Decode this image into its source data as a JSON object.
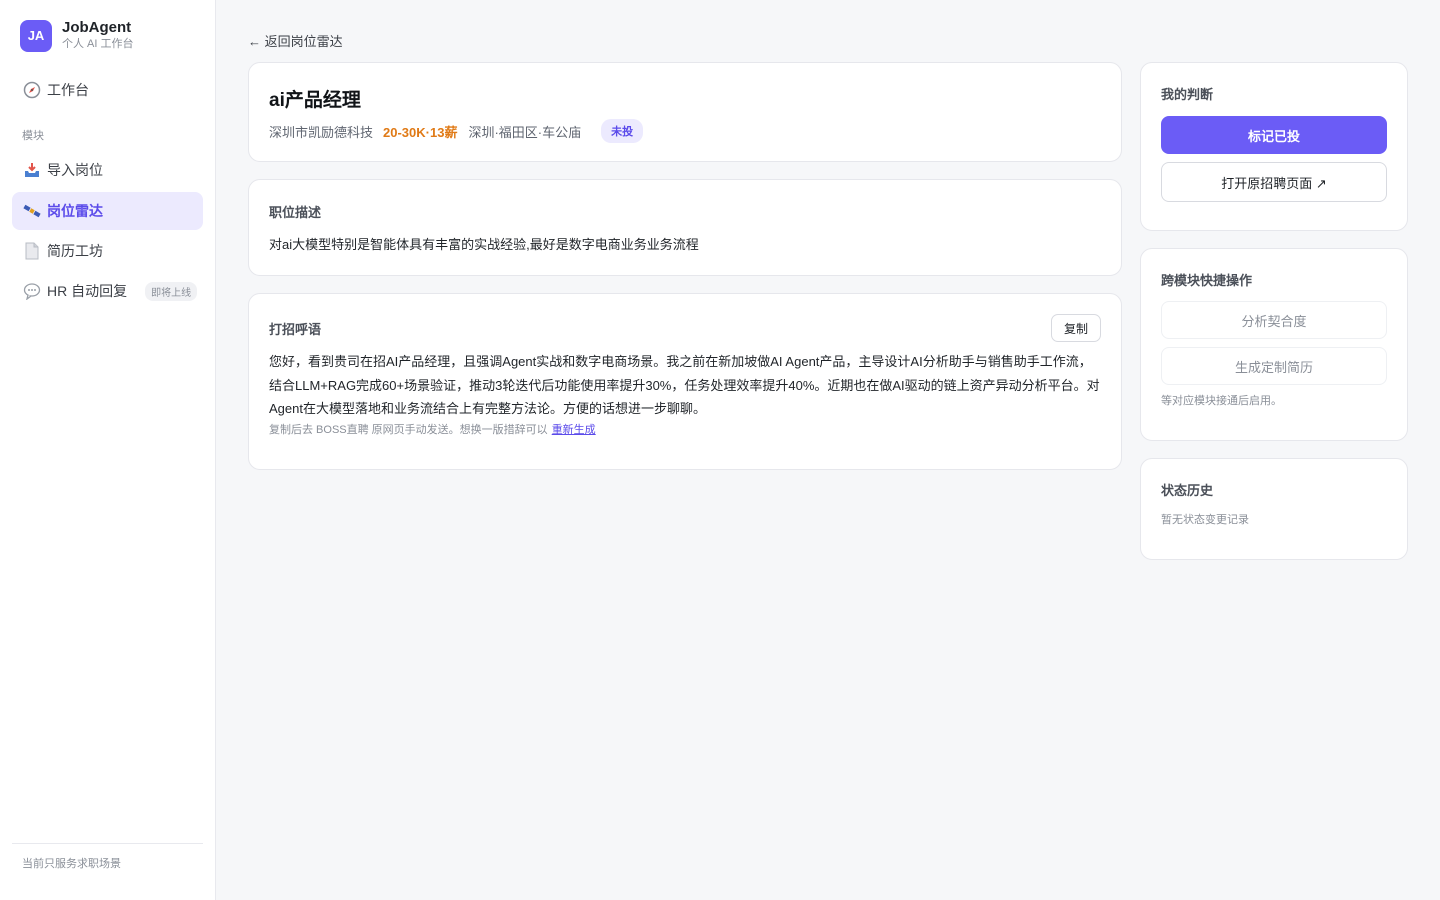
{
  "brand": {
    "logo": "JA",
    "name": "JobAgent",
    "subtitle": "个人 AI 工作台"
  },
  "nav": {
    "workbench": {
      "icon": "compass-icon",
      "label": "工作台"
    },
    "section_label": "模块",
    "items": [
      {
        "icon": "inbox-tray-icon",
        "label": "导入岗位"
      },
      {
        "icon": "satellite-icon",
        "label": "岗位雷达",
        "active": true
      },
      {
        "icon": "document-icon",
        "label": "简历工坊"
      },
      {
        "icon": "speech-bubble-icon",
        "label": "HR 自动回复",
        "badge": "即将上线"
      }
    ],
    "footer": "当前只服务求职场景"
  },
  "back_link": "← 返回岗位雷达",
  "job": {
    "title": "ai产品经理",
    "company": "深圳市凯励德科技",
    "salary": "20-30K·13薪",
    "location": "深圳·福田区·车公庙",
    "status": "未投"
  },
  "description": {
    "label": "职位描述",
    "text": "对ai大模型特别是智能体具有丰富的实战经验,最好是数字电商业务业务流程"
  },
  "greeting": {
    "label": "打招呼语",
    "copy_label": "复制",
    "text": "您好，看到贵司在招AI产品经理，且强调Agent实战和数字电商场景。我之前在新加坡做AI Agent产品，主导设计AI分析助手与销售助手工作流，结合LLM+RAG完成60+场景验证，推动3轮迭代后功能使用率提升30%，任务处理效率提升40%。近期也在做AI驱动的链上资产异动分析平台。对Agent在大模型落地和业务流结合上有完整方法论。方便的话想进一步聊聊。",
    "hint": "复制后去 BOSS直聘 原网页手动发送。想换一版措辞可以",
    "regenerate": "重新生成"
  },
  "judgement": {
    "label": "我的判断",
    "mark_applied": "标记已投",
    "open_original": "打开原招聘页面 ↗"
  },
  "quick_actions": {
    "label": "跨模块快捷操作",
    "analyze": "分析契合度",
    "generate_resume": "生成定制简历",
    "note": "等对应模块接通后启用。"
  },
  "history": {
    "label": "状态历史",
    "empty": "暂无状态变更记录"
  },
  "colors": {
    "accent": "#6b5cf6",
    "salary": "#e07a16",
    "background": "#f6f7f9"
  }
}
